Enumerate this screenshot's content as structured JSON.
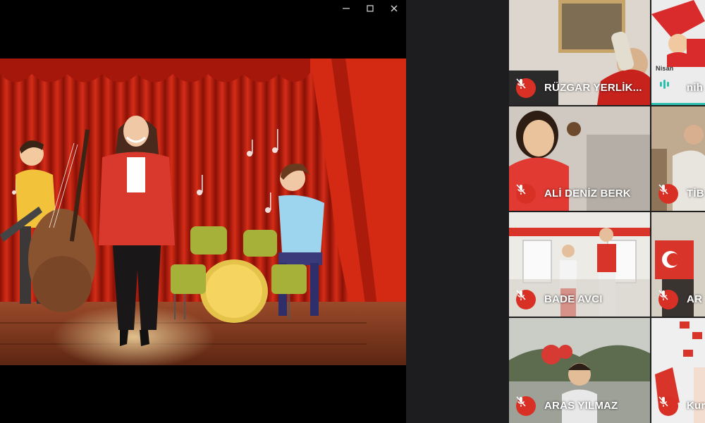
{
  "window": {
    "minimize_icon": "minimize-icon",
    "maximize_icon": "maximize-icon",
    "close_icon": "close-icon"
  },
  "participants": [
    {
      "name": "RÜZGAR YERLİK...",
      "mic": "muted"
    },
    {
      "name": "nih",
      "mic": "speaking"
    },
    {
      "name": "ALİ DENİZ BERK",
      "mic": "muted"
    },
    {
      "name": "TİB",
      "mic": "muted"
    },
    {
      "name": "BADE AVCI",
      "mic": "muted"
    },
    {
      "name": "AR",
      "mic": "muted"
    },
    {
      "name": "ARAS YILMAZ",
      "mic": "muted"
    },
    {
      "name": "Kur",
      "mic": "muted"
    }
  ],
  "tile_texts": {
    "nisan": "Nisan"
  },
  "colors": {
    "muted_red": "#d93025",
    "speaking_teal": "#2bbfae",
    "curtain_red": "#c8220f"
  }
}
